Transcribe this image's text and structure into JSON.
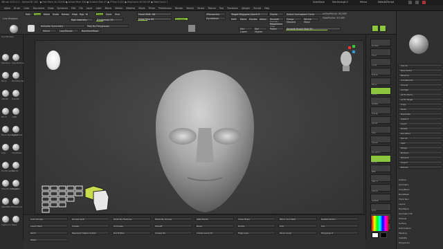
{
  "titlebar": {
    "text": "ZBrush 2022.0.1 · Sphere3D 128 · ● Free Mem 44.152GB ● Active Mem 226 ● Scratch Disk 47 ● ZTime 0.422 ● PolyCount 49.205 KP ● MeshCount 1",
    "quicksave": "QuickSave",
    "see_through": "See-through 0",
    "menus": "Menus",
    "default_zscript": "DefaultZScript"
  },
  "menubar": {
    "items": [
      "Alpha",
      "Brush",
      "Color",
      "Document",
      "Draw",
      "Dynamics",
      "Edit",
      "File",
      "Layer",
      "Light",
      "Macro",
      "Marker",
      "Material",
      "Movie",
      "Picker",
      "Preferences",
      "Render",
      "Stencil",
      "Stroke",
      "Texture",
      "Tool",
      "Transform",
      "Zplugin",
      "Zscript",
      "Help"
    ]
  },
  "toolbar": {
    "lightbox": "Live Boolean",
    "edit": "Edit",
    "draw": "Draw",
    "move": "Move",
    "scale": "Scale",
    "rotate": "Rotate",
    "mrgb": "Mrgb",
    "rgb": "Rgb",
    "m": "M",
    "zadd": "Zadd",
    "zsub": "Zsub",
    "zcut": "Zcut",
    "rgb_intensity": "Rgb Intensity",
    "z_intensity": "Z Intensity 25",
    "focal_shift": "Focal Shift -56",
    "draw_size": "Draw Size 64",
    "dynamic": "Dynamic",
    "active_points": "ActivePoints: 49,569",
    "total_points": "TotalPoints: 49,569",
    "sym": "Activate Symmetry",
    "poly_by_group": "Poly By Polygroups",
    "mirror": "Mirror",
    "lazy_mouse": "LazyMouse",
    "backface_mask": "BackfaceMask",
    "dynamesh": "DynaMesh",
    "zremesher": "ZRemesher",
    "target_polys": "Target Polygons Count 5",
    "half": "Half",
    "same": "Same",
    "double": "Double",
    "adapt": "Adapt",
    "smooth_subdiv": "Smooth Subdiv",
    "divide": "Divide",
    "resolution": "Resolution 128",
    "polish": "Polish",
    "del_lower": "Del Lower",
    "del_higher": "Del Higher",
    "sdiv": "SDiv 1",
    "select_unmasked": "Select Unmasked Circle",
    "shadow": "Shadow",
    "group_masked": "Group Masked",
    "shrink_mask": "Shrink Mask",
    "smooth_brush_mod": "Smooth Brush Mod 90",
    "frame": "Frame"
  },
  "leftshelf": {
    "top_label": "Live Boolean",
    "items": [
      "Standard",
      "Clay Buildup",
      "Move",
      "DamStandard",
      "hPolish",
      "Smooth",
      "Pinch",
      "Inflat",
      "Move Topological",
      "SnakeHook",
      "Clay",
      "ClayTubes",
      "TrimDynamic",
      "Slash3",
      "Smooth Stronger",
      "MaskPen",
      "SelectRect",
      "SliceCurve",
      "ClipCurve",
      "Mask"
    ]
  },
  "rightshelf": {
    "items": [
      "Double",
      "Floor",
      "Local",
      "Frame",
      "Move",
      "Scale",
      "Rotate",
      "Transp",
      "Ghost",
      "Solo",
      "Xpose",
      "Dynamic",
      "Persp",
      "BPR",
      "SPix 3",
      "Actual",
      "AAHalf",
      "Grid",
      "Dynamic",
      "Smooth"
    ]
  },
  "rightpanel": {
    "sections": [
      "Subtool",
      "Geometry",
      "ArrayMesh",
      "NanoMesh",
      "Thick Skin",
      "Layers",
      "FiberMesh",
      "Geometry HD",
      "Preview",
      "Surface",
      "Deformation",
      "Masking",
      "Visibility",
      "Polygroups",
      "Contact",
      "Morph Target",
      "Polypaint",
      "UV Map",
      "Texture Map",
      "Displacement Map",
      "Normal Map",
      "Vector Displacement Map",
      "Display Properties",
      "Unified Skin",
      "Initialize",
      "Import",
      "Export"
    ],
    "subtool_items": [
      "List All",
      "New Folder",
      "Rename",
      "AutoReorder",
      "All Low",
      "All High",
      "All To Home",
      "All To Target",
      "Copy",
      "Paste",
      "Duplicate",
      "Append",
      "Insert",
      "Delete",
      "Del Other",
      "Del All",
      "Split",
      "Merge",
      "Boolean",
      "Remesh",
      "Project",
      "Extract"
    ],
    "color_swatch_fg": "#ffffff",
    "color_swatch_bg": "#000000"
  },
  "bottombar": {
    "items": [
      "Auto Groups",
      "Groups Split",
      "Polish By Features",
      "Polish By Groups",
      "Weld Points",
      "Close Holes",
      "Mirror And Weld",
      "Delete Hidden",
      "Insert Mesh",
      "Crease",
      "UnCrease",
      "ShowEl",
      "Bevel",
      "Divide",
      "Smt",
      "Suv",
      "ReUV",
      "Reproject Higher Subdiv",
      "Del Hidden",
      "Crease PG",
      "Crease Level 15",
      "Edge Loop",
      "Panel Loops",
      "Polygroup It",
      "Stitch"
    ],
    "transform_labels": [
      "Move",
      "Scale",
      "Rotate"
    ]
  },
  "viewport": {
    "gizmo_label": "head-preview"
  },
  "colors": {
    "accent": "#8cc63e",
    "bg": "#2b2b2b",
    "panel": "#303030"
  }
}
